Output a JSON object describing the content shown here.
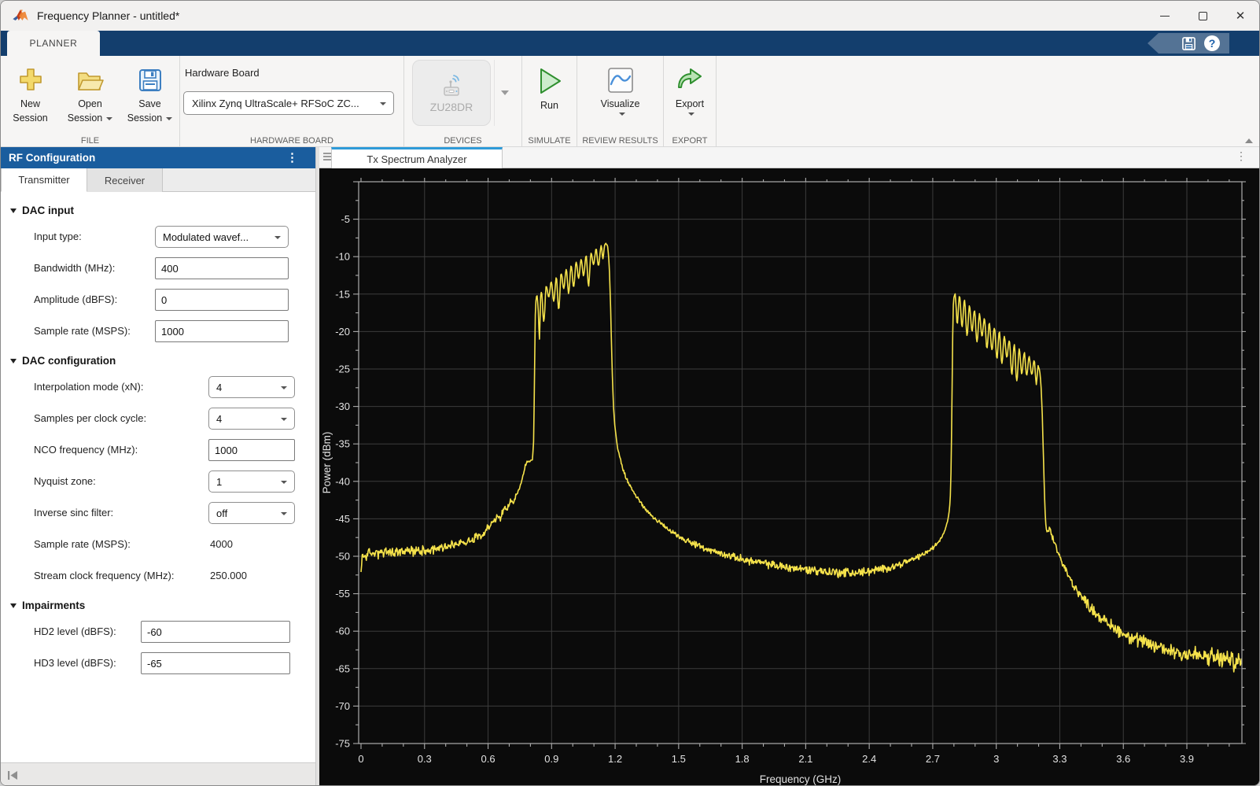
{
  "window": {
    "title": "Frequency Planner - untitled*"
  },
  "ribbon": {
    "tab": "PLANNER",
    "accent": "#133e6d",
    "help_label": "?"
  },
  "toolstrip": {
    "file": {
      "label": "FILE",
      "new": "New Session",
      "open": "Open Session",
      "save": "Save Session"
    },
    "hardware_board": {
      "label": "HARDWARE BOARD",
      "field_label": "Hardware Board",
      "value": "Xilinx Zynq UltraScale+ RFSoC ZC..."
    },
    "devices": {
      "label": "DEVICES",
      "device": "ZU28DR"
    },
    "simulate": {
      "label": "SIMULATE",
      "run": "Run"
    },
    "review": {
      "label": "REVIEW RESULTS",
      "visualize": "Visualize"
    },
    "export": {
      "label": "EXPORT",
      "export": "Export"
    }
  },
  "left_panel": {
    "title": "RF Configuration",
    "tabs": [
      "Transmitter",
      "Receiver"
    ],
    "active_tab": "Transmitter",
    "sections": [
      {
        "title": "DAC input",
        "rows": [
          {
            "label": "Input type:",
            "control": "dropdown",
            "value": "Modulated wavef..."
          },
          {
            "label": "Bandwidth (MHz):",
            "control": "input",
            "value": "400"
          },
          {
            "label": "Amplitude (dBFS):",
            "control": "input",
            "value": "0"
          },
          {
            "label": "Sample rate (MSPS):",
            "control": "input",
            "value": "1000"
          }
        ]
      },
      {
        "title": "DAC configuration",
        "rows": [
          {
            "label": "Interpolation mode (xN):",
            "control": "dropdown",
            "value": "4"
          },
          {
            "label": "Samples per clock cycle:",
            "control": "dropdown",
            "value": "4"
          },
          {
            "label": "NCO frequency (MHz):",
            "control": "input",
            "value": "1000"
          },
          {
            "label": "Nyquist zone:",
            "control": "dropdown",
            "value": "1"
          },
          {
            "label": "Inverse sinc filter:",
            "control": "dropdown",
            "value": "off"
          },
          {
            "label": "Sample rate (MSPS):",
            "control": "static",
            "value": "4000"
          },
          {
            "label": "Stream clock frequency (MHz):",
            "control": "static",
            "value": "250.000"
          }
        ]
      },
      {
        "title": "Impairments",
        "rows": [
          {
            "label": "HD2 level (dBFS):",
            "control": "input",
            "value": "-60"
          },
          {
            "label": "HD3 level (dBFS):",
            "control": "input",
            "value": "-65"
          }
        ]
      }
    ]
  },
  "right_panel": {
    "tab": "Tx Spectrum Analyzer"
  },
  "chart_data": {
    "type": "line",
    "title": "Tx Spectrum Analyzer",
    "xlabel": "Frequency (GHz)",
    "ylabel": "Power (dBm)",
    "xlim": [
      0,
      4.16
    ],
    "ylim": [
      -75,
      0
    ],
    "xticks": [
      0,
      0.3,
      0.6,
      0.9,
      1.2,
      1.5,
      1.8,
      2.1,
      2.4,
      2.7,
      3,
      3.3,
      3.6,
      3.9
    ],
    "yticks": [
      -5,
      -10,
      -15,
      -20,
      -25,
      -30,
      -35,
      -40,
      -45,
      -50,
      -55,
      -60,
      -65,
      -70,
      -75
    ],
    "x_minor_step": 0.1,
    "y_minor_step": 2.5,
    "grid": true,
    "background": "#0b0b0b",
    "grid_color": "#3c3c3c",
    "axis_color": "#adadad",
    "label_color": "#e2e2e2",
    "line_color": "#f5e24b",
    "description": "Tx spectrum: main 400 MHz modulated band 0.82-1.17 GHz rising from -15 to -8 dBm, image band 2.80-3.20 GHz falling from -15 to -25 dBm, noise floor -50 dBm falling to -64 dBm at 4.1 GHz",
    "series": [
      {
        "name": "Tx spectrum",
        "envelope_points": [
          [
            0,
            -52.5
          ],
          [
            0.005,
            -50
          ],
          [
            0.05,
            -49.6
          ],
          [
            0.15,
            -49.5
          ],
          [
            0.25,
            -49.3
          ],
          [
            0.35,
            -49
          ],
          [
            0.45,
            -48.4
          ],
          [
            0.52,
            -47.8
          ],
          [
            0.58,
            -46.8
          ],
          [
            0.62,
            -45.6
          ],
          [
            0.645,
            -44.6
          ],
          [
            0.66,
            -44.9
          ],
          [
            0.675,
            -43.6
          ],
          [
            0.69,
            -43.9
          ],
          [
            0.705,
            -42.6
          ],
          [
            0.72,
            -42.9
          ],
          [
            0.735,
            -41.6
          ],
          [
            0.75,
            -40.9
          ],
          [
            0.762,
            -39.6
          ],
          [
            0.772,
            -38.2
          ],
          [
            0.78,
            -37.6
          ],
          [
            0.795,
            -37.4
          ],
          [
            0.81,
            -37.1
          ],
          [
            0.816,
            -34
          ],
          [
            0.82,
            -24
          ],
          [
            0.824,
            -16.2
          ],
          [
            0.832,
            -15
          ],
          [
            0.838,
            -15.4
          ],
          [
            0.843,
            -18.8
          ],
          [
            0.848,
            -15
          ],
          [
            0.86,
            -14.6
          ],
          [
            0.9,
            -13.4
          ],
          [
            0.95,
            -12.2
          ],
          [
            1,
            -11.2
          ],
          [
            1.05,
            -10.2
          ],
          [
            1.1,
            -9.3
          ],
          [
            1.13,
            -8.7
          ],
          [
            1.148,
            -8.3
          ],
          [
            1.158,
            -8.2
          ],
          [
            1.165,
            -8.6
          ],
          [
            1.172,
            -11
          ],
          [
            1.178,
            -16
          ],
          [
            1.185,
            -24
          ],
          [
            1.192,
            -30
          ],
          [
            1.2,
            -33
          ],
          [
            1.21,
            -35.2
          ],
          [
            1.222,
            -36.8
          ],
          [
            1.235,
            -38.2
          ],
          [
            1.25,
            -39.4
          ],
          [
            1.27,
            -40.6
          ],
          [
            1.3,
            -42
          ],
          [
            1.33,
            -43.2
          ],
          [
            1.37,
            -44.5
          ],
          [
            1.42,
            -45.8
          ],
          [
            1.47,
            -46.8
          ],
          [
            1.53,
            -47.8
          ],
          [
            1.6,
            -48.7
          ],
          [
            1.68,
            -49.5
          ],
          [
            1.76,
            -50.1
          ],
          [
            1.85,
            -50.7
          ],
          [
            1.95,
            -51.2
          ],
          [
            2.05,
            -51.6
          ],
          [
            2.15,
            -51.9
          ],
          [
            2.25,
            -52.2
          ],
          [
            2.35,
            -52.2
          ],
          [
            2.45,
            -51.8
          ],
          [
            2.52,
            -51.3
          ],
          [
            2.58,
            -50.7
          ],
          [
            2.63,
            -50.1
          ],
          [
            2.67,
            -49.5
          ],
          [
            2.7,
            -48.9
          ],
          [
            2.725,
            -48.2
          ],
          [
            2.745,
            -47.3
          ],
          [
            2.76,
            -46.3
          ],
          [
            2.771,
            -45.2
          ],
          [
            2.779,
            -43.8
          ],
          [
            2.784,
            -41.5
          ],
          [
            2.788,
            -36
          ],
          [
            2.792,
            -26
          ],
          [
            2.796,
            -16.8
          ],
          [
            2.801,
            -15.1
          ],
          [
            2.81,
            -15
          ],
          [
            2.85,
            -16
          ],
          [
            2.9,
            -17.3
          ],
          [
            2.95,
            -18.6
          ],
          [
            3,
            -19.8
          ],
          [
            3.05,
            -21
          ],
          [
            3.1,
            -22.2
          ],
          [
            3.15,
            -23.4
          ],
          [
            3.185,
            -24.2
          ],
          [
            3.198,
            -24.6
          ],
          [
            3.205,
            -25.2
          ],
          [
            3.211,
            -27
          ],
          [
            3.217,
            -31
          ],
          [
            3.223,
            -37
          ],
          [
            3.229,
            -43
          ],
          [
            3.234,
            -46
          ],
          [
            3.243,
            -46.8
          ],
          [
            3.252,
            -46.5
          ],
          [
            3.262,
            -47.2
          ],
          [
            3.275,
            -48.2
          ],
          [
            3.29,
            -49.3
          ],
          [
            3.31,
            -50.8
          ],
          [
            3.33,
            -52
          ],
          [
            3.36,
            -53.6
          ],
          [
            3.4,
            -55.3
          ],
          [
            3.45,
            -57
          ],
          [
            3.5,
            -58.4
          ],
          [
            3.56,
            -59.6
          ],
          [
            3.62,
            -60.6
          ],
          [
            3.7,
            -61.6
          ],
          [
            3.78,
            -62.3
          ],
          [
            3.88,
            -62.9
          ],
          [
            3.98,
            -63.4
          ],
          [
            4.08,
            -63.8
          ],
          [
            4.16,
            -64.2
          ]
        ],
        "noise_amplitude_points": [
          [
            0,
            0.9
          ],
          [
            0.55,
            0.7
          ],
          [
            0.75,
            0.4
          ],
          [
            0.8,
            0.2
          ],
          [
            0.82,
            0.15
          ],
          [
            1.15,
            0.15
          ],
          [
            1.2,
            0.2
          ],
          [
            1.35,
            0.3
          ],
          [
            1.5,
            0.4
          ],
          [
            1.7,
            0.55
          ],
          [
            1.9,
            0.65
          ],
          [
            2.1,
            0.75
          ],
          [
            2.3,
            0.8
          ],
          [
            2.5,
            0.6
          ],
          [
            2.7,
            0.35
          ],
          [
            2.78,
            0.15
          ],
          [
            3.21,
            0.15
          ],
          [
            3.26,
            0.5
          ],
          [
            3.4,
            0.8
          ],
          [
            3.6,
            1.1
          ],
          [
            3.8,
            1.3
          ],
          [
            4,
            1.5
          ],
          [
            4.16,
            1.7
          ]
        ],
        "ripple_bands": [
          {
            "from": 0.828,
            "to": 1.152,
            "period": 0.0235,
            "depth": 3.3
          },
          {
            "from": 2.803,
            "to": 3.2,
            "period": 0.0235,
            "depth": 3.3
          }
        ]
      }
    ]
  }
}
